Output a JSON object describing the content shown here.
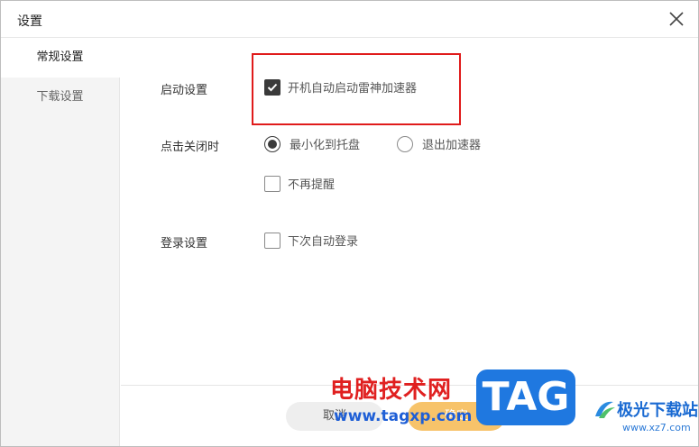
{
  "window": {
    "title": "设置"
  },
  "sidebar": {
    "items": [
      {
        "label": "常规设置"
      },
      {
        "label": "下载设置"
      }
    ]
  },
  "settings": {
    "startup": {
      "label": "启动设置",
      "option": "开机自动启动雷神加速器",
      "checked": true
    },
    "on_close": {
      "label": "点击关闭时",
      "options": [
        {
          "label": "最小化到托盘",
          "selected": true
        },
        {
          "label": "退出加速器",
          "selected": false
        }
      ],
      "no_remind": {
        "label": "不再提醒",
        "checked": false
      }
    },
    "login": {
      "label": "登录设置",
      "option": "下次自动登录",
      "checked": false
    }
  },
  "footer": {
    "cancel_label": "取消",
    "ok_label": "确定"
  },
  "watermark": {
    "line1": "电脑技术网",
    "line2": "www.tagxp.com",
    "tag": "TAG",
    "site_name": "极光下载站",
    "site_url": "www.xz7.com"
  },
  "colors": {
    "highlight": "#e01b1b",
    "ok_button": "#f7c36a"
  }
}
